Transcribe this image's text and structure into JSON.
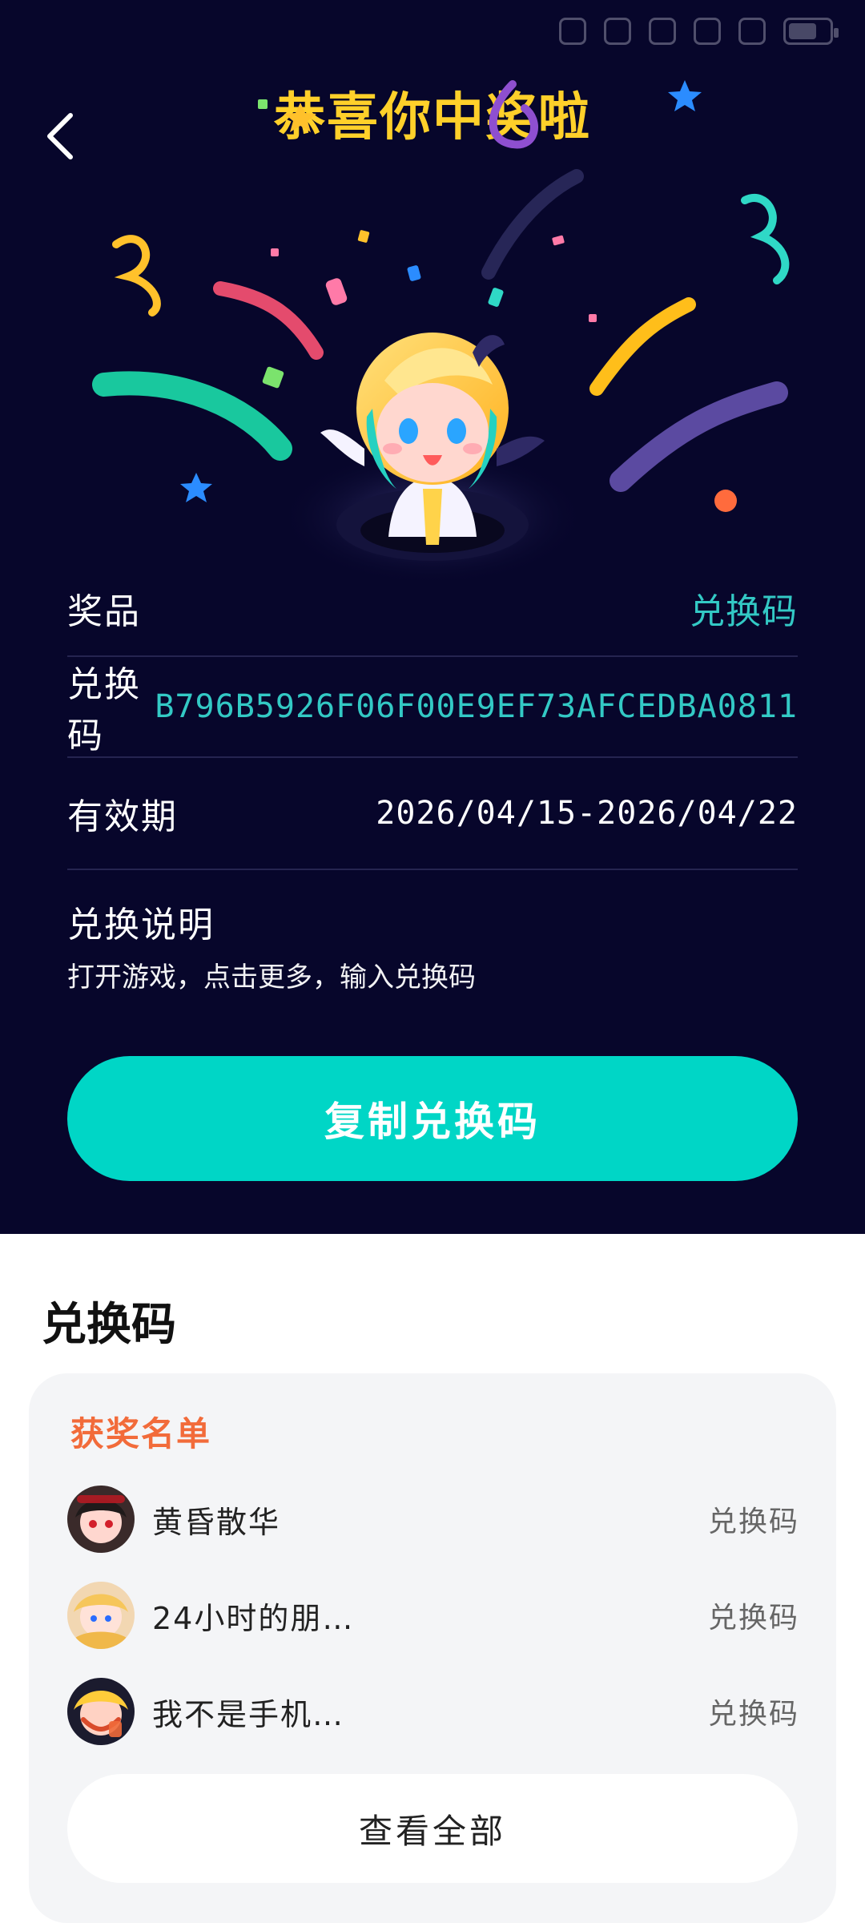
{
  "header": {
    "title": "恭喜你中奖啦"
  },
  "details": {
    "prize_label": "奖品",
    "prize_value": "兑换码",
    "code_label": "兑换码",
    "code_value": "B796B5926F06F00E9EF73AFCEDBA0811",
    "validity_label": "有效期",
    "validity_value": "2026/04/15-2026/04/22",
    "instructions_label": "兑换说明",
    "instructions_text": "打开游戏，点击更多，输入兑换码"
  },
  "actions": {
    "copy_label": "复制兑换码"
  },
  "bottom": {
    "section_title": "兑换码",
    "winners_heading": "获奖名单",
    "winners": [
      {
        "name": "黄昏散华",
        "prize": "兑换码"
      },
      {
        "name": "24小时的朋…",
        "prize": "兑换码"
      },
      {
        "name": "我不是手机…",
        "prize": "兑换码"
      }
    ],
    "view_all_label": "查看全部"
  },
  "colors": {
    "background": "#07062b",
    "title": "#ffd02a",
    "accent": "#33c9c5",
    "button": "#00d6c6",
    "winners_heading": "#f26b3a"
  },
  "icons": {
    "back": "chevron-left-icon",
    "status": [
      "eye-icon",
      "notification-icon",
      "bell-icon",
      "wifi-icon",
      "signal-icon",
      "battery-icon"
    ]
  }
}
